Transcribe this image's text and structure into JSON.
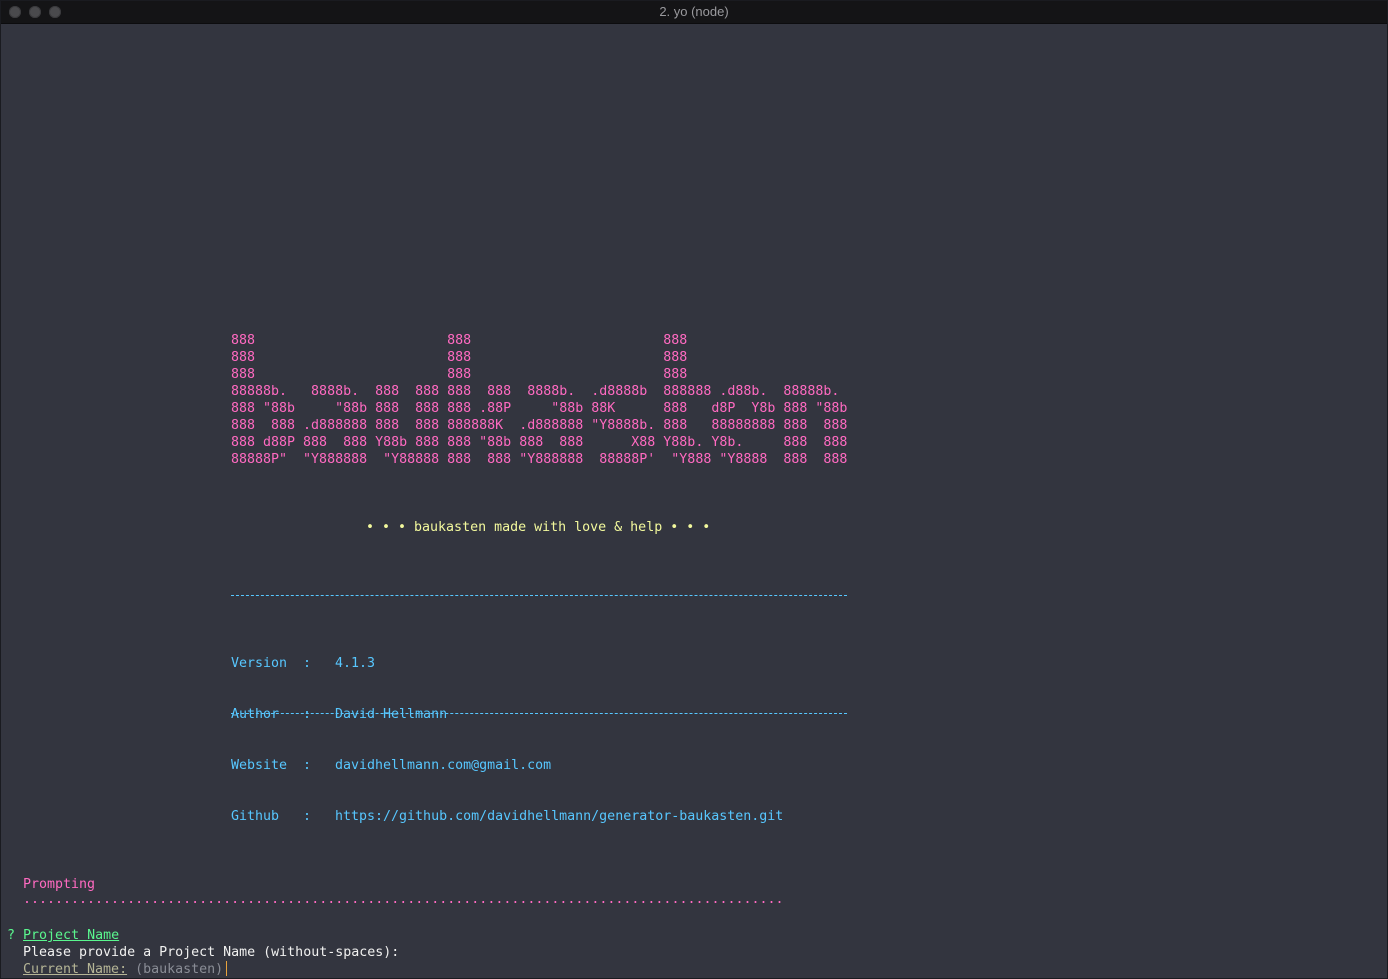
{
  "window": {
    "title": "2. yo (node)"
  },
  "banner": {
    "ascii_art": "888                        888                        888\n888                        888                        888\n888                        888                        888\n88888b.   8888b.  888  888 888  888  8888b.  .d8888b  888888 .d88b.  88888b.\n888 \"88b     \"88b 888  888 888 .88P     \"88b 88K      888   d8P  Y8b 888 \"88b\n888  888 .d888888 888  888 888888K  .d888888 \"Y8888b. 888   88888888 888  888\n888 d88P 888  888 Y88b 888 888 \"88b 888  888      X88 Y88b. Y8b.     888  888\n88888P\"  \"Y888888  \"Y88888 888  888 \"Y888888  88888P'  \"Y888 \"Y8888  888  888",
    "tagline": "• • • baukasten made with love & help • • •"
  },
  "info": {
    "rows": [
      {
        "key": "Version",
        "sep": ":",
        "value": "4.1.3"
      },
      {
        "key": "Author",
        "sep": ":",
        "value": "David Hellmann"
      },
      {
        "key": "Website",
        "sep": ":",
        "value": "davidhellmann.com@gmail.com"
      },
      {
        "key": "Github",
        "sep": ":",
        "value": "https://github.com/davidhellmann/generator-baukasten.git"
      }
    ]
  },
  "prompt": {
    "section_title": "Prompting",
    "dots": "...............................................................................................",
    "question_mark": "?",
    "question_label": "Project Name",
    "description": "Please provide a Project Name (without-spaces):",
    "current_label": "Current Name:",
    "current_value": "(baukasten)"
  },
  "colors": {
    "background": "#33353f",
    "pink": "#ff6ac1",
    "yellow": "#f3f99d",
    "cyan": "#57c7ff",
    "green": "#5af78e",
    "cursor": "#e8a33d"
  }
}
